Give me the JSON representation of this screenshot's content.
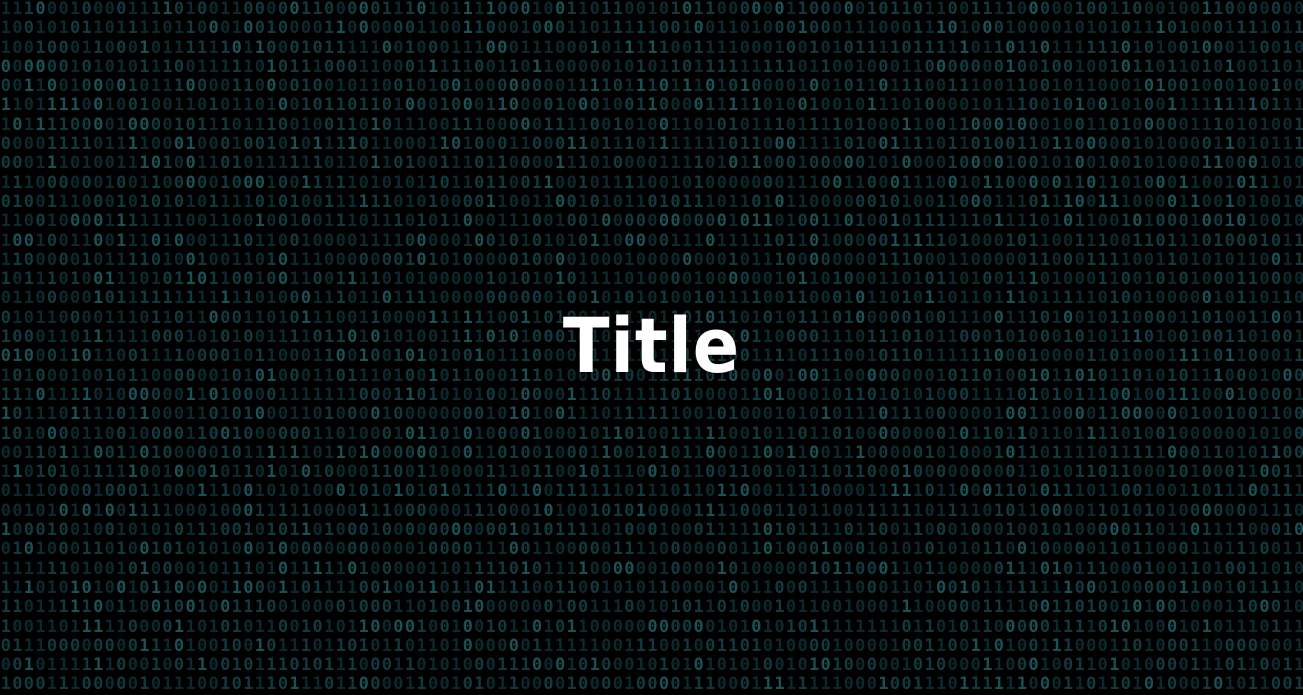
{
  "title": "Title",
  "background": {
    "style": "binary-digit rain",
    "colors": {
      "base": "#000000",
      "digit_dim": "#0c2a2d",
      "digit_mid": "#123a3e",
      "digit_bright": "#1b5055",
      "title": "#ffffff"
    }
  }
}
